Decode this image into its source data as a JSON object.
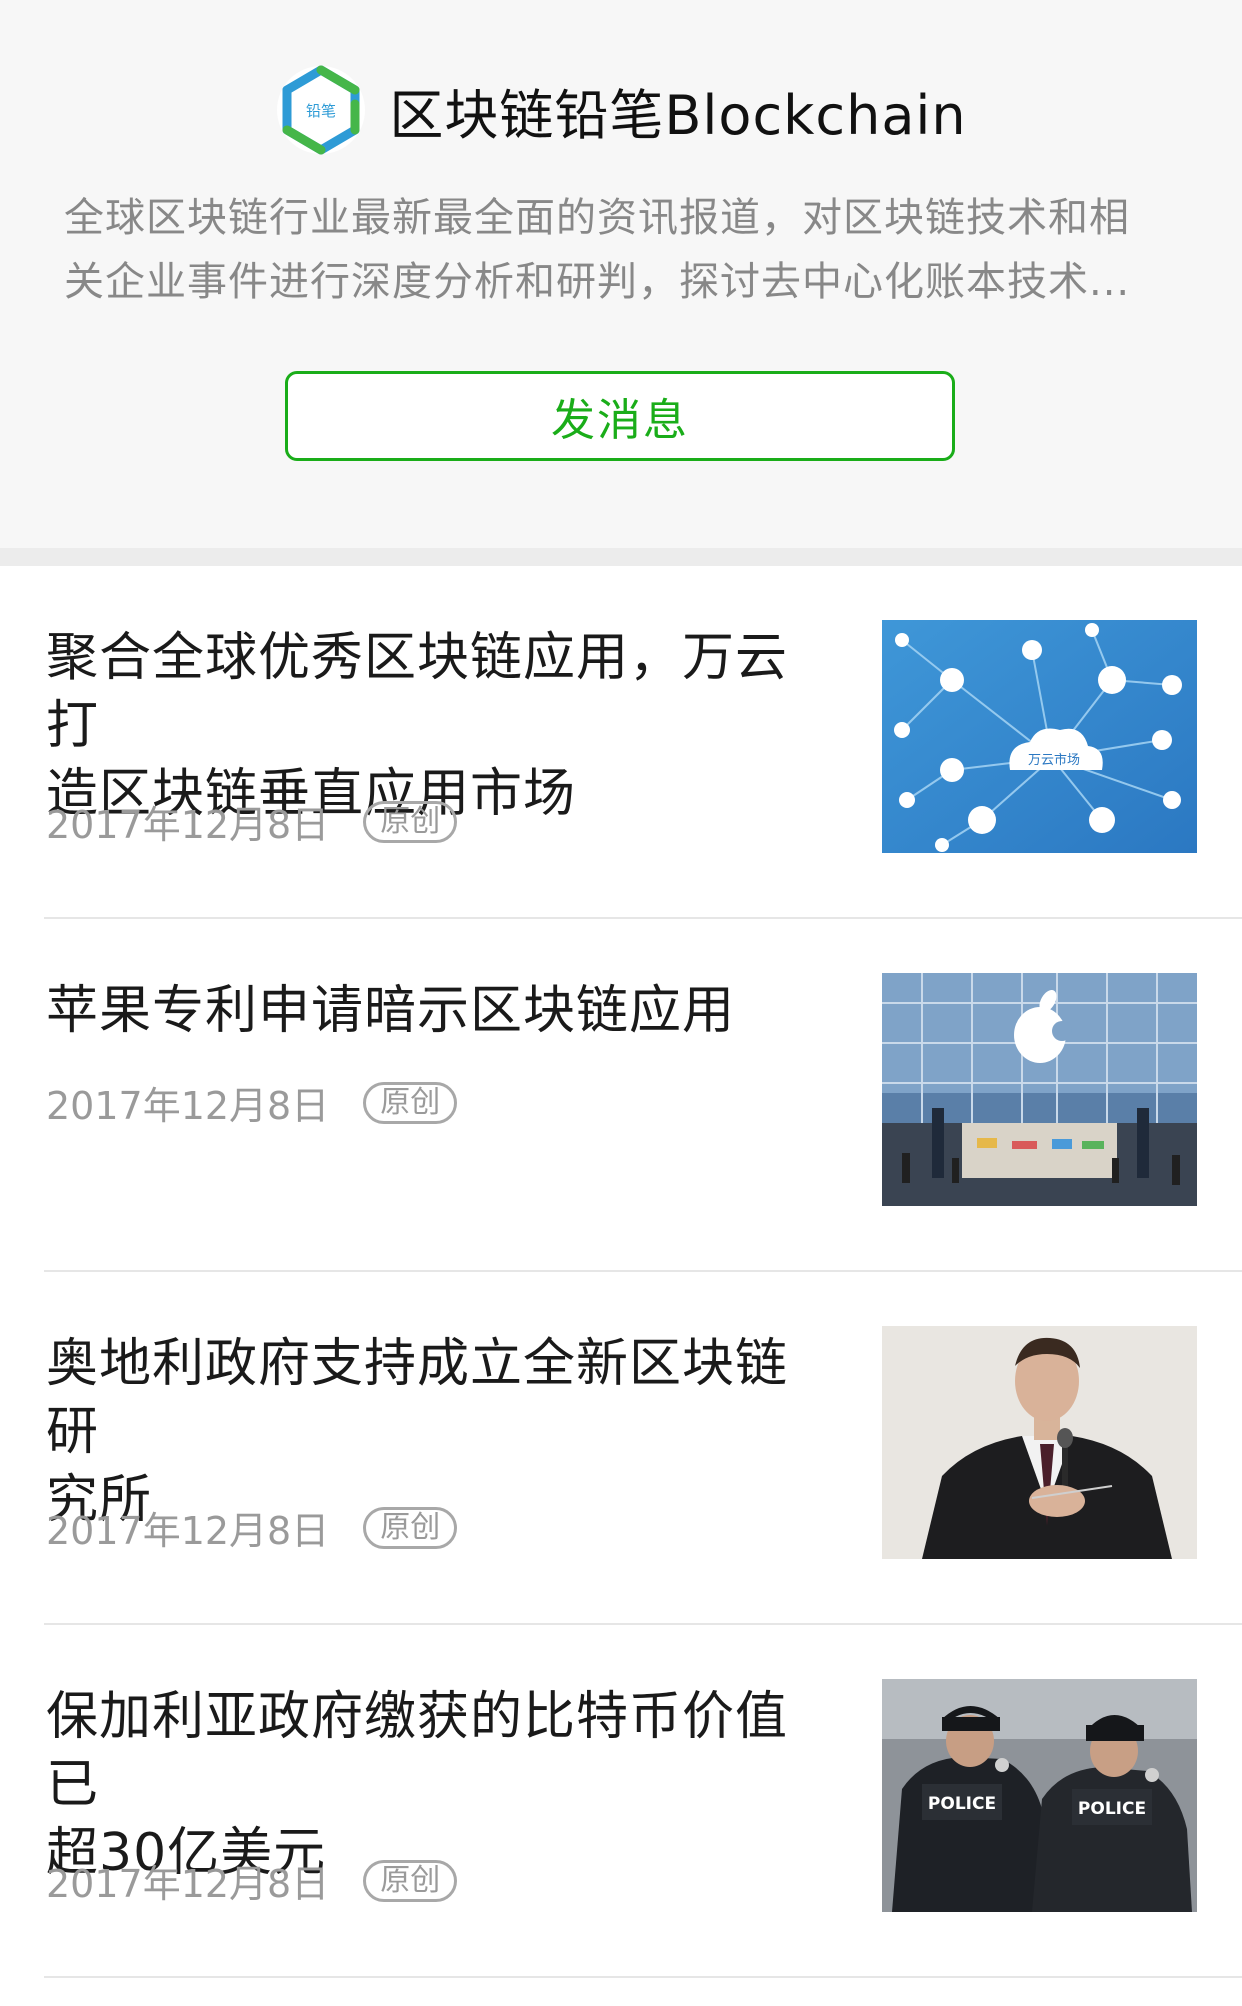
{
  "account": {
    "name": "区块链铅笔Blockchain",
    "logo_icon": "blockchain-pencil-logo-icon",
    "logo_text": "铅笔",
    "description_lines": [
      "全球区块链行业最新最全面的资讯报道，对区块链技术和相",
      "关企业事件进行深度分析和研判，探讨去中心化账本技术..."
    ],
    "message_button": "发消息"
  },
  "colors": {
    "accent": "#1aad19",
    "muted_text": "#9a9a9a"
  },
  "articles": [
    {
      "title_lines": [
        "聚合全球优秀区块链应用，万云打",
        "造区块链垂直应用市场"
      ],
      "date": "2017年12月8日",
      "badge": "原创",
      "thumb_label": "万云市场",
      "thumb_icon": "cloud-network-thumbnail"
    },
    {
      "title_lines": [
        "苹果专利申请暗示区块链应用"
      ],
      "date": "2017年12月8日",
      "badge": "原创",
      "thumb_icon": "apple-store-thumbnail"
    },
    {
      "title_lines": [
        "奥地利政府支持成立全新区块链研",
        "究所"
      ],
      "date": "2017年12月8日",
      "badge": "原创",
      "thumb_icon": "speaker-with-microphone-thumbnail"
    },
    {
      "title_lines": [
        "保加利亚政府缴获的比特币价值已",
        "超30亿美元"
      ],
      "date": "2017年12月8日",
      "badge": "原创",
      "thumb_label": "POLICE",
      "thumb_icon": "police-officers-thumbnail"
    }
  ]
}
